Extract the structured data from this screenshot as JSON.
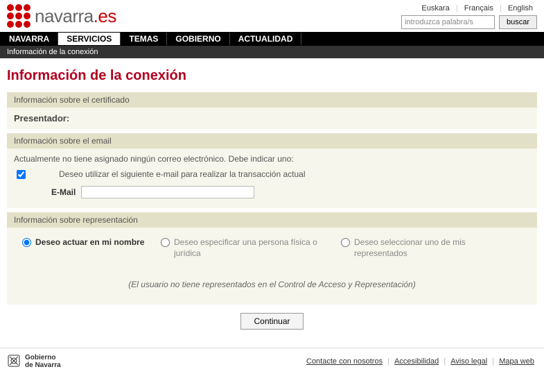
{
  "header": {
    "logo_text_main": "navarra",
    "logo_text_suffix": ".es",
    "languages": {
      "eu": "Euskara",
      "fr": "Français",
      "en": "English"
    },
    "search_placeholder": "introduzca palabra/s",
    "search_button": "buscar"
  },
  "nav": {
    "items": [
      {
        "label": "NAVARRA"
      },
      {
        "label": "SERVICIOS"
      },
      {
        "label": "TEMAS"
      },
      {
        "label": "GOBIERNO"
      },
      {
        "label": "ACTUALIDAD"
      }
    ],
    "breadcrumb": "Información de la conexión"
  },
  "page_title": "Información de la conexión",
  "cert_section": {
    "heading": "Información sobre el certificado",
    "presenter_label": "Presentador:"
  },
  "email_section": {
    "heading": "Información sobre el email",
    "note": "Actualmente no tiene asignado ningún correo electrónico. Debe indicar uno:",
    "checkbox_label": "Deseo utilizar el siguiente e-mail para realizar la transacción actual",
    "email_label": "E-Mail",
    "email_value": ""
  },
  "rep_section": {
    "heading": "Información sobre representación",
    "options": [
      {
        "label": "Deseo actuar en mi nombre"
      },
      {
        "label": "Deseo especificar una persona física o jurídica"
      },
      {
        "label": "Deseo seleccionar uno de mis representados"
      }
    ],
    "no_reps_msg": "(El usuario no tiene representados en el Control de Acceso y Representación)"
  },
  "continue_button": "Continuar",
  "footer": {
    "gov_line1": "Gobierno",
    "gov_line2": "de Navarra",
    "links": {
      "contact": "Contacte con nosotros",
      "accessibility": "Accesibilidad",
      "legal": "Aviso legal",
      "sitemap": "Mapa web"
    }
  }
}
